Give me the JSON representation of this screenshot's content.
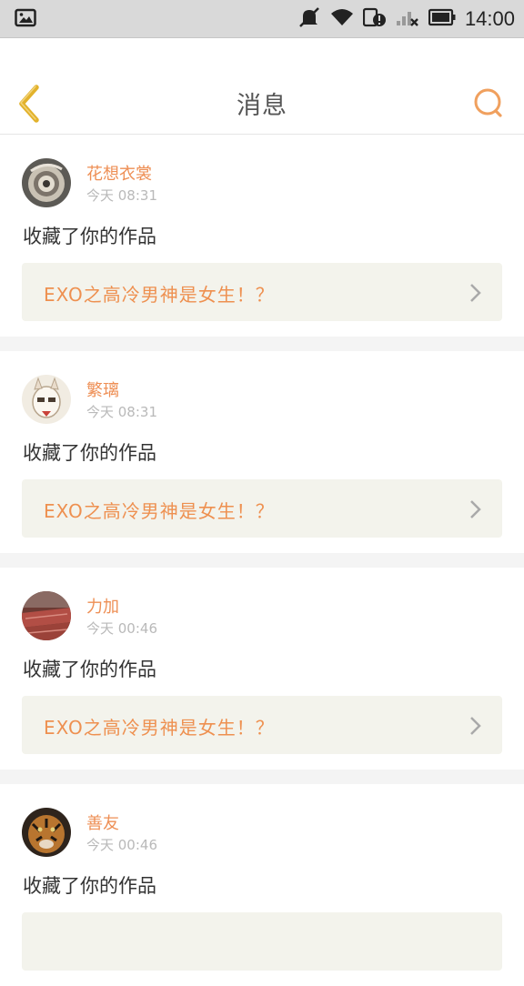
{
  "statusbar": {
    "time": "14:00"
  },
  "header": {
    "title": "消息"
  },
  "messages": [
    {
      "user": "花想衣裳",
      "time": "今天 08:31",
      "action": "收藏了你的作品",
      "work": "EXO之高冷男神是女生！？"
    },
    {
      "user": "繁璃",
      "time": "今天 08:31",
      "action": "收藏了你的作品",
      "work": "EXO之高冷男神是女生！？"
    },
    {
      "user": "力加",
      "time": "今天 00:46",
      "action": "收藏了你的作品",
      "work": "EXO之高冷男神是女生！？"
    },
    {
      "user": "善友",
      "time": "今天 00:46",
      "action": "收藏了你的作品",
      "work": ""
    }
  ],
  "colors": {
    "accent": "#ee8f55",
    "back_arrow": "#e6b230",
    "card_link_bg": "#f3f3ec"
  }
}
